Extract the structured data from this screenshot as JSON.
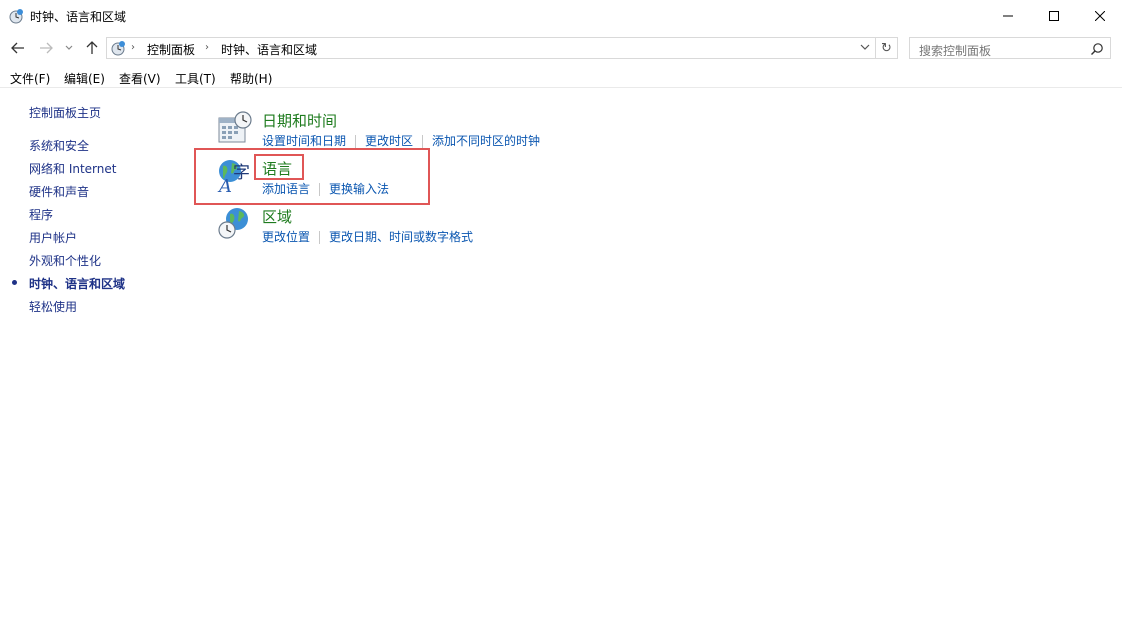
{
  "window": {
    "title": "时钟、语言和区域"
  },
  "address": {
    "crumbs": [
      "控制面板",
      "时钟、语言和区域"
    ]
  },
  "search": {
    "placeholder": "搜索控制面板"
  },
  "menu": {
    "items": [
      "文件(F)",
      "编辑(E)",
      "查看(V)",
      "工具(T)",
      "帮助(H)"
    ]
  },
  "sidebar": {
    "items": [
      {
        "label": "控制面板主页"
      },
      {
        "label": "系统和安全"
      },
      {
        "label": "网络和 Internet"
      },
      {
        "label": "硬件和声音"
      },
      {
        "label": "程序"
      },
      {
        "label": "用户帐户"
      },
      {
        "label": "外观和个性化"
      },
      {
        "label": "时钟、语言和区域",
        "active": true
      },
      {
        "label": "轻松使用"
      }
    ]
  },
  "categories": [
    {
      "title": "日期和时间",
      "icon": "calendar-clock-icon",
      "links": [
        "设置时间和日期",
        "更改时区",
        "添加不同时区的时钟"
      ]
    },
    {
      "title": "语言",
      "icon": "language-globe-icon",
      "links": [
        "添加语言",
        "更换输入法"
      ]
    },
    {
      "title": "区域",
      "icon": "region-globe-clock-icon",
      "links": [
        "更改位置",
        "更改日期、时间或数字格式"
      ]
    }
  ],
  "colors": {
    "category_title": "#1e7b1e",
    "link": "#0a56b0",
    "sidebar_link": "#1e3287",
    "highlight": "#e05656"
  }
}
